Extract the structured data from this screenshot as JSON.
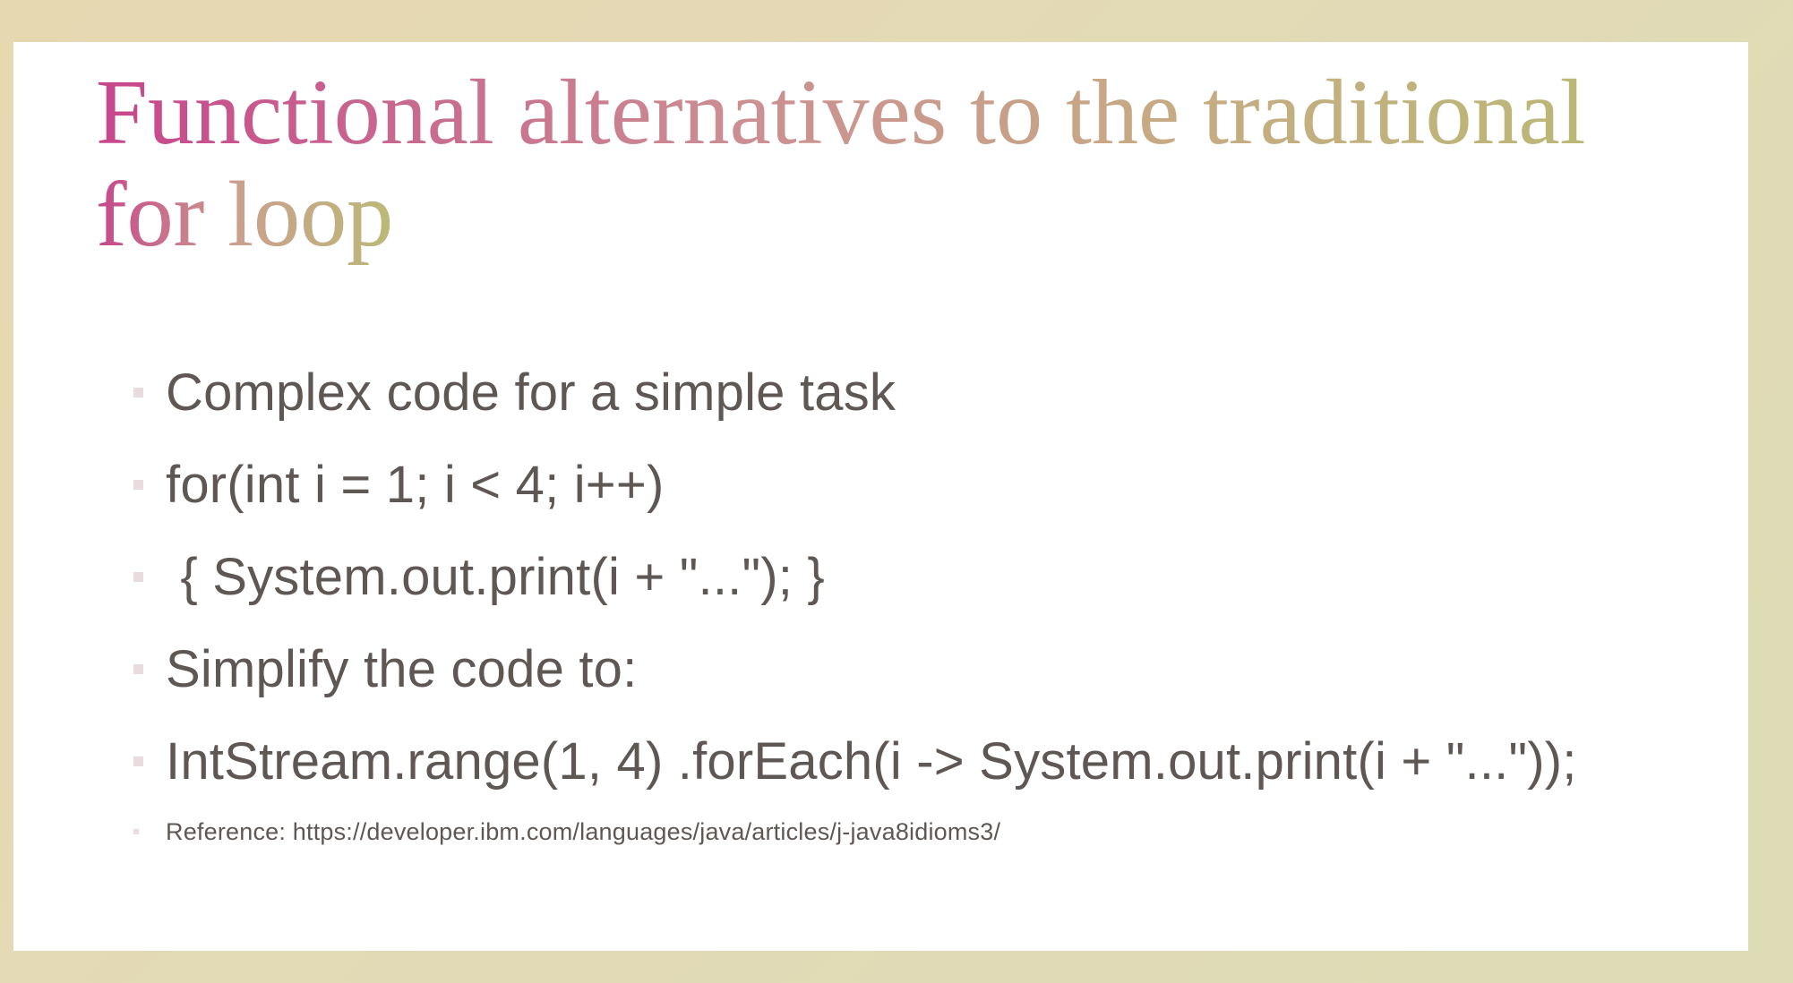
{
  "slide": {
    "title_line1": "Functional alternatives to the traditional",
    "title_line2": "for loop",
    "bullets": [
      "Complex code for a simple task",
      "for(int i = 1; i < 4; i++)",
      " { System.out.print(i + \"...\"); }",
      "Simplify the code to:",
      "IntStream.range(1, 4) .forEach(i -> System.out.print(i + \"...\"));"
    ],
    "reference": "Reference: https://developer.ibm.com/languages/java/articles/j-java8idioms3/"
  },
  "colors": {
    "title_gradient_start": "#c7468c",
    "title_gradient_end": "#b7bc72",
    "body_text": "#5f5754",
    "background": "#e6d8b1"
  }
}
